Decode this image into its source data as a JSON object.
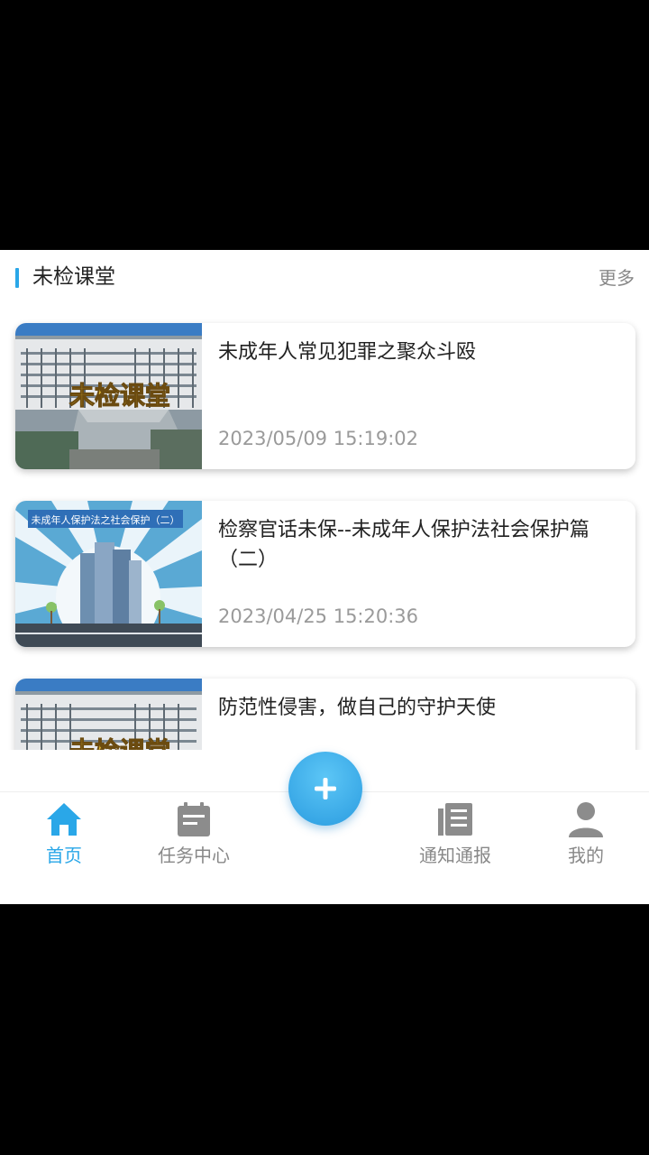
{
  "section": {
    "title": "未检课堂",
    "more": "更多"
  },
  "articles": [
    {
      "title": "未成年人常见犯罪之聚众斗殴",
      "date": "2023/05/09 15:19:02",
      "thumb_text": "未检课堂"
    },
    {
      "title": "检察官话未保--未成年人保护法社会保护篇（二）",
      "date": "2023/04/25 15:20:36",
      "thumb_text": "未成年人保护法之社会保护（二）"
    },
    {
      "title": "防范性侵害，做自己的守护天使",
      "date": "",
      "thumb_text": "未检课堂"
    }
  ],
  "tabbar": {
    "tabs": [
      {
        "label": "首页",
        "icon": "home-icon",
        "active": true
      },
      {
        "label": "任务中心",
        "icon": "clipboard-icon",
        "active": false
      },
      {
        "label": "通知通报",
        "icon": "document-icon",
        "active": false
      },
      {
        "label": "我的",
        "icon": "user-icon",
        "active": false
      }
    ],
    "fab_icon": "plus-icon"
  },
  "colors": {
    "accent": "#2aa7e8",
    "inactive": "#888888",
    "date_text": "#9a9a9a"
  }
}
